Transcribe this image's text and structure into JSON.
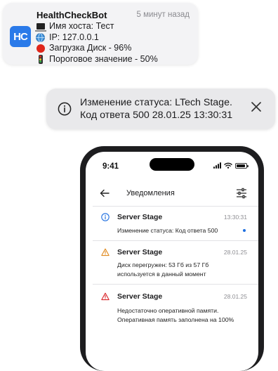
{
  "bot": {
    "avatar_text": "HC",
    "name": "HealthCheckBot",
    "time": "5 минут назад",
    "lines": [
      {
        "icon": "laptop-icon",
        "text": "Имя хоста: Тест"
      },
      {
        "icon": "globe-icon",
        "text": "IP: 127.0.0.1"
      },
      {
        "icon": "red-circle-icon",
        "text": "Загрузка Диск - 96%"
      },
      {
        "icon": "traffic-light-icon",
        "text": "Пороговое значение - 50%"
      }
    ]
  },
  "toast": {
    "icon": "info-icon",
    "line1": "Изменение статуса: LTech Stage.",
    "line2": "Код ответа 500 28.01.25 13:30:31",
    "close_icon": "close-icon"
  },
  "phone": {
    "status_time": "9:41",
    "header": {
      "title": "Уведомления",
      "back_icon": "back-arrow-icon",
      "filter_icon": "filter-settings-icon"
    },
    "notifications": [
      {
        "icon": "info-icon",
        "icon_color": "#1f6fe0",
        "title": "Server Stage",
        "time": "13:30:31",
        "body": [
          "Изменение статуса: Код ответа 500"
        ],
        "unread": true
      },
      {
        "icon": "warning-icon",
        "icon_color": "#e08a1f",
        "title": "Server Stage",
        "time": "28.01.25",
        "body": [
          "Диск перегружен: 53 Гб из 57 Гб",
          "используется в данный момент"
        ],
        "unread": false
      },
      {
        "icon": "alert-icon",
        "icon_color": "#d9262b",
        "title": "Server Stage",
        "time": "28.01.25",
        "body": [
          "Недостаточно оперативной памяти.",
          "Оперативная память заполнена на 100%"
        ],
        "unread": false
      }
    ]
  }
}
